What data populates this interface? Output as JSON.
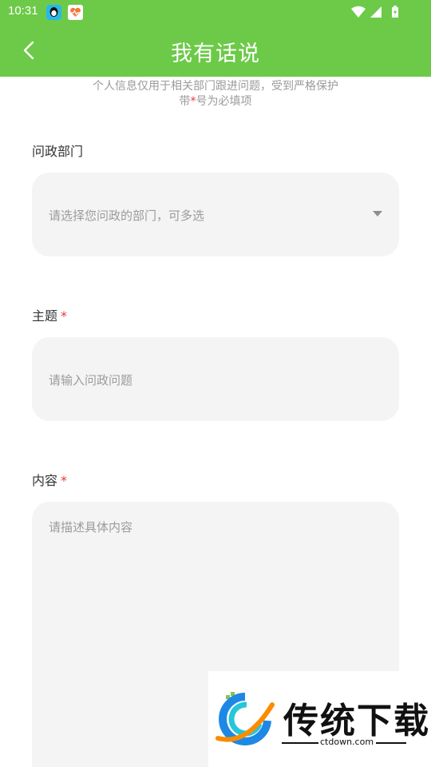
{
  "status_bar": {
    "time": "10:31",
    "icons": [
      "qq-app-icon",
      "health-app-icon",
      "wifi-icon",
      "signal-icon",
      "battery-icon"
    ]
  },
  "header": {
    "title": "我有话说",
    "back_icon": "chevron-left-icon",
    "color": "#6cca48"
  },
  "notice": {
    "line1": "个人信息仅用于相关部门跟进问题，受到严格保护",
    "line2_prefix": "带",
    "line2_star": "*",
    "line2_suffix": "号为必填项"
  },
  "form": {
    "department": {
      "label": "问政部门",
      "placeholder": "请选择您问政的部门，可多选",
      "dropdown_icon": "caret-down-icon"
    },
    "subject": {
      "label": "主题",
      "required_mark": "*",
      "placeholder": "请输入问政问题"
    },
    "content": {
      "label": "内容",
      "required_mark": "*",
      "placeholder": "请描述具体内容"
    }
  },
  "watermark": {
    "text": "传统下载",
    "url": "ctdown.com",
    "logo_icon": "ctdown-logo-icon"
  },
  "colors": {
    "accent": "#6cca48",
    "required": "#e53935",
    "field_bg": "#f4f4f4",
    "placeholder": "#9b9b9b"
  }
}
